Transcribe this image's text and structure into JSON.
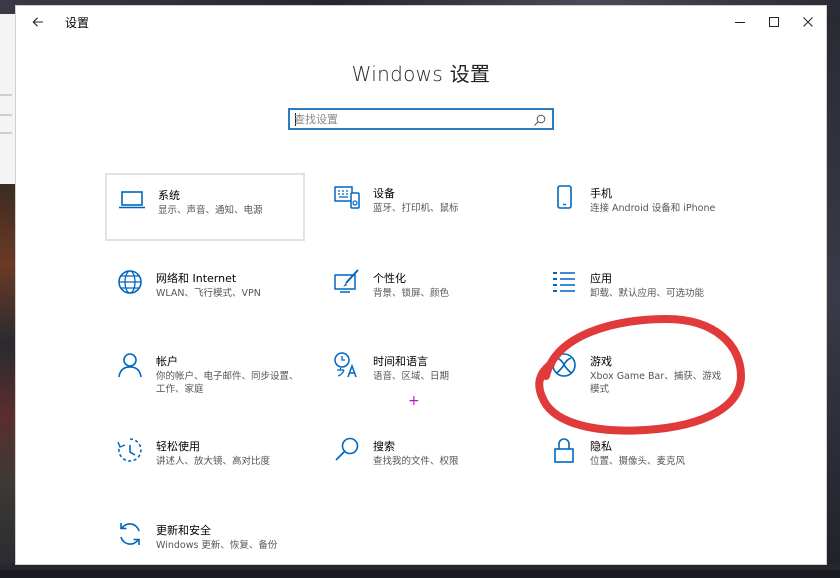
{
  "window": {
    "title": "设置",
    "controls": [
      "minimize",
      "maximize",
      "close"
    ]
  },
  "page": {
    "title": "Windows 设置"
  },
  "search": {
    "placeholder": "查找设置"
  },
  "tiles": [
    {
      "name": "系统",
      "desc": "显示、声音、通知、电源",
      "icon": "laptop-icon"
    },
    {
      "name": "设备",
      "desc": "蓝牙、打印机、鼠标",
      "icon": "keyboard-device-icon"
    },
    {
      "name": "手机",
      "desc": "连接 Android 设备和 iPhone",
      "icon": "phone-icon"
    },
    {
      "name": "网络和 Internet",
      "desc": "WLAN、飞行模式、VPN",
      "icon": "globe-icon"
    },
    {
      "name": "个性化",
      "desc": "背景、锁屏、颜色",
      "icon": "paintbrush-icon"
    },
    {
      "name": "应用",
      "desc": "卸载、默认应用、可选功能",
      "icon": "apps-list-icon"
    },
    {
      "name": "帐户",
      "desc": "你的帐户、电子邮件、同步设置、工作、家庭",
      "icon": "person-icon"
    },
    {
      "name": "时间和语言",
      "desc": "语音、区域、日期",
      "icon": "time-language-icon"
    },
    {
      "name": "游戏",
      "desc": "Xbox Game Bar、捕获、游戏模式",
      "icon": "xbox-icon"
    },
    {
      "name": "轻松使用",
      "desc": "讲述人、放大镜、高对比度",
      "icon": "ease-of-access-icon"
    },
    {
      "name": "搜索",
      "desc": "查找我的文件、权限",
      "icon": "search-icon"
    },
    {
      "name": "隐私",
      "desc": "位置、摄像头、麦克风",
      "icon": "lock-icon"
    },
    {
      "name": "更新和安全",
      "desc": "Windows 更新、恢复、备份",
      "icon": "sync-icon"
    }
  ],
  "colors": {
    "accent": "#0067c0",
    "search_border": "#2b7ac2",
    "annotation_red": "#e03a3a",
    "annotation_plus": "#b21fbf"
  }
}
